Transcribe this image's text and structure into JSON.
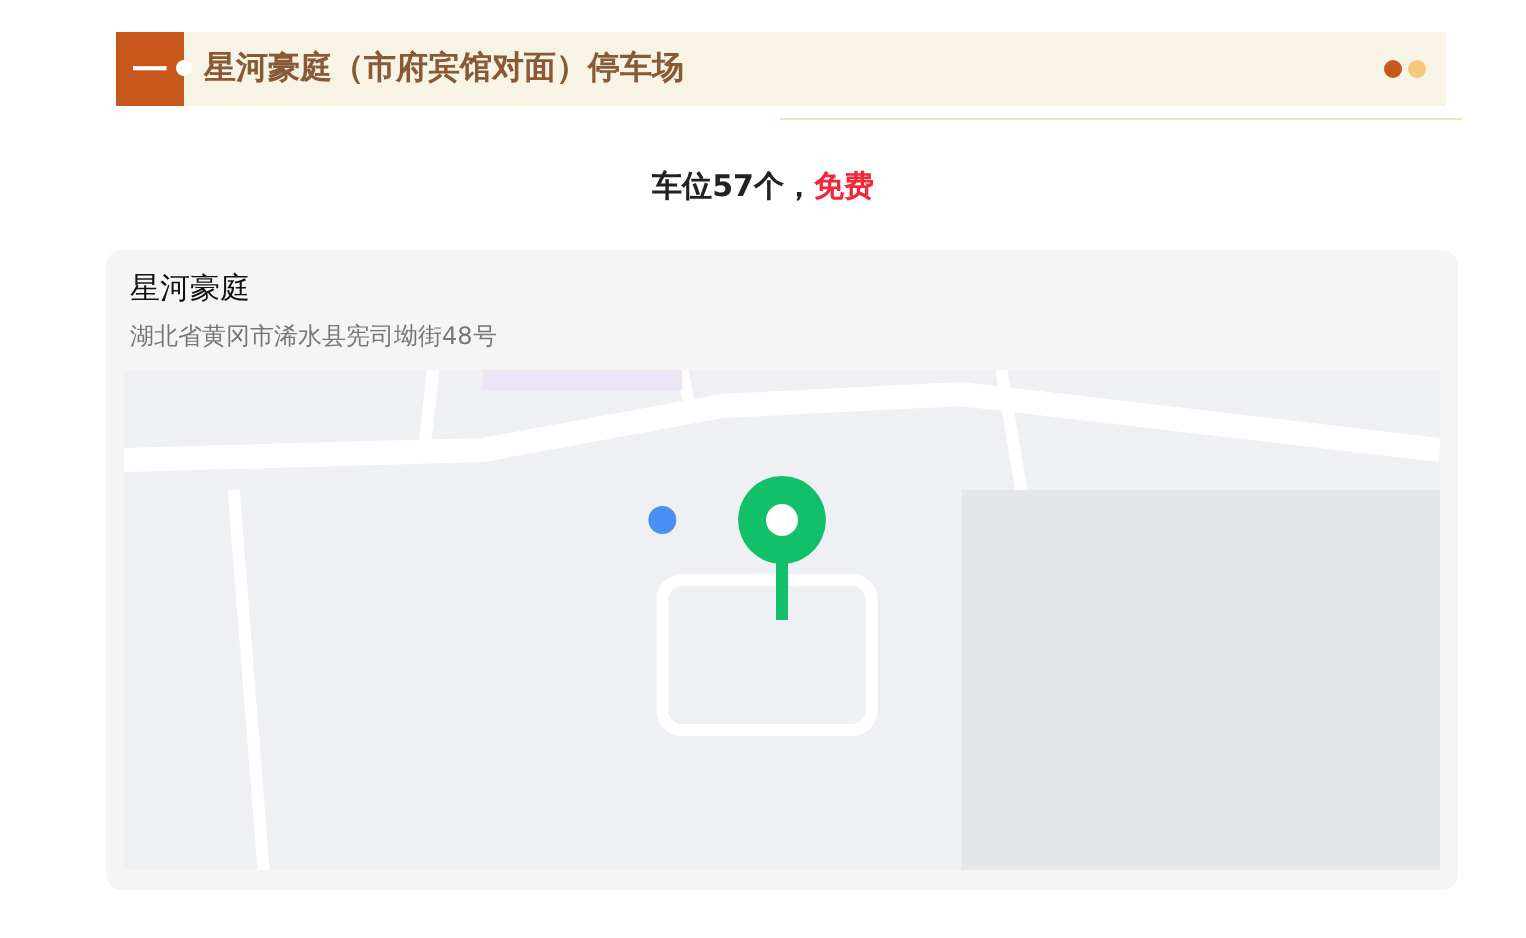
{
  "header": {
    "badge": "一",
    "title": "星河豪庭（市府宾馆对面）停车场"
  },
  "summary": {
    "spaces": "车位57个，",
    "price": "免费"
  },
  "location": {
    "name": "星河豪庭",
    "address": "湖北省黄冈市浠水县宪司坳街48号"
  }
}
